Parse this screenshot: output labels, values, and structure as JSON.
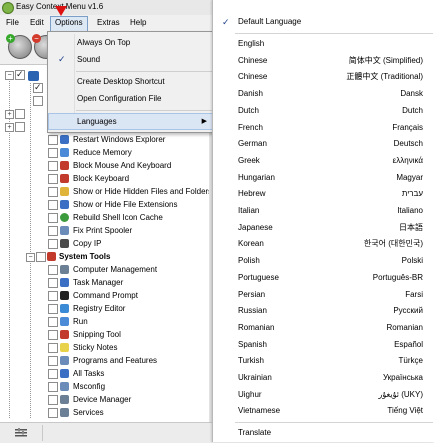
{
  "window": {
    "title": "Easy Context Menu v1.6"
  },
  "menubar": {
    "items": [
      "File",
      "Edit",
      "Options",
      "Extras",
      "Help"
    ]
  },
  "options_menu": {
    "items": [
      {
        "label": "Always On Top",
        "checked": false
      },
      {
        "label": "Sound",
        "checked": true
      },
      {
        "label": "Create Desktop Shortcut",
        "checked": false
      },
      {
        "label": "Open Configuration File",
        "checked": false
      },
      {
        "label": "Languages",
        "checked": false,
        "submenu": true
      }
    ]
  },
  "languages_menu": {
    "default": {
      "label": "Default Language",
      "checked": true
    },
    "languages": [
      {
        "en": "English",
        "native": ""
      },
      {
        "en": "Chinese",
        "native": "简体中文 (Simplified)"
      },
      {
        "en": "Chinese",
        "native": "正體中文 (Traditional)"
      },
      {
        "en": "Danish",
        "native": "Dansk"
      },
      {
        "en": "Dutch",
        "native": "Dutch"
      },
      {
        "en": "French",
        "native": "Français"
      },
      {
        "en": "German",
        "native": "Deutsch"
      },
      {
        "en": "Greek",
        "native": "ελληνικά"
      },
      {
        "en": "Hungarian",
        "native": "Magyar"
      },
      {
        "en": "Hebrew",
        "native": "עברית"
      },
      {
        "en": "Italian",
        "native": "Italiano"
      },
      {
        "en": "Japanese",
        "native": "日本語"
      },
      {
        "en": "Korean",
        "native": "한국어 (대한민국)"
      },
      {
        "en": "Polish",
        "native": "Polski"
      },
      {
        "en": "Portuguese",
        "native": "Português-BR"
      },
      {
        "en": "Persian",
        "native": "Farsi"
      },
      {
        "en": "Russian",
        "native": "Русский"
      },
      {
        "en": "Romanian",
        "native": "Romanian"
      },
      {
        "en": "Spanish",
        "native": "Español"
      },
      {
        "en": "Turkish",
        "native": "Türkçe"
      },
      {
        "en": "Ukrainian",
        "native": "Українська"
      },
      {
        "en": "Uighur",
        "native": "ئۇيغۇر (UKY)"
      },
      {
        "en": "Vietnamese",
        "native": "Tiếng Việt"
      }
    ],
    "translate": "Translate"
  },
  "tree": {
    "group_items": [
      {
        "label": "Restart Windows Explorer",
        "checked": false,
        "icon_color": "#3b6fc4"
      },
      {
        "label": "Reduce Memory",
        "checked": false,
        "icon_color": "#4a8ad6"
      },
      {
        "label": "Block Mouse And Keyboard",
        "checked": false,
        "icon_color": "#c23a2b"
      },
      {
        "label": "Block Keyboard",
        "checked": false,
        "icon_color": "#c23a2b"
      },
      {
        "label": "Show or Hide Hidden Files and Folders",
        "checked": false,
        "icon_color": "#e0b43a"
      },
      {
        "label": "Show or Hide File Extensions",
        "checked": false,
        "icon_color": "#3b6fc4"
      },
      {
        "label": "Rebuild Shell Icon Cache",
        "checked": false,
        "icon_color": "#3b9a3b"
      },
      {
        "label": "Fix Print Spooler",
        "checked": false,
        "icon_color": "#6b8bb8"
      },
      {
        "label": "Copy IP",
        "checked": false,
        "icon_color": "#4a4a4a"
      }
    ],
    "system_tools": {
      "label": "System Tools",
      "items": [
        {
          "label": "Computer Management",
          "checked": false,
          "icon_color": "#6b7f95"
        },
        {
          "label": "Task Manager",
          "checked": false,
          "icon_color": "#3b6fc4"
        },
        {
          "label": "Command Prompt",
          "checked": false,
          "icon_color": "#222222"
        },
        {
          "label": "Registry Editor",
          "checked": false,
          "icon_color": "#3b8ad6"
        },
        {
          "label": "Run",
          "checked": false,
          "icon_color": "#4a8ad6"
        },
        {
          "label": "Snipping Tool",
          "checked": false,
          "icon_color": "#c23a2b"
        },
        {
          "label": "Sticky Notes",
          "checked": false,
          "icon_color": "#e8d24a"
        },
        {
          "label": "Programs and Features",
          "checked": false,
          "icon_color": "#6b8bb8"
        },
        {
          "label": "All Tasks",
          "checked": false,
          "icon_color": "#3b6fc4"
        },
        {
          "label": "Msconfig",
          "checked": false,
          "icon_color": "#6b8bb8"
        },
        {
          "label": "Device Manager",
          "checked": false,
          "icon_color": "#6b7f95"
        },
        {
          "label": "Services",
          "checked": false,
          "icon_color": "#6b7f95"
        }
      ]
    }
  },
  "colors": {
    "menu_check": "#1e3f8c",
    "highlight": "#dbe6f4",
    "annotation_arrow": "#dd1111"
  }
}
